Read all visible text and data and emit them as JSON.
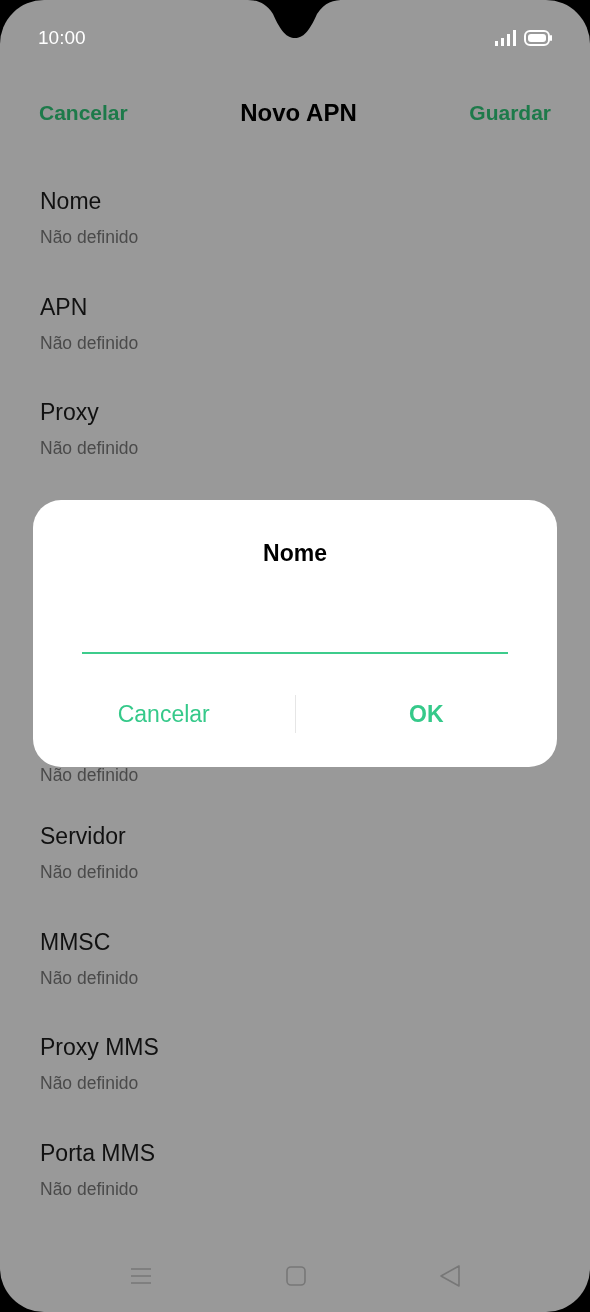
{
  "status_bar": {
    "time": "10:00"
  },
  "header": {
    "cancel": "Cancelar",
    "title": "Novo APN",
    "save": "Guardar"
  },
  "settings": [
    {
      "title": "Nome",
      "value": "Não definido"
    },
    {
      "title": "APN",
      "value": "Não definido"
    },
    {
      "title": "Proxy",
      "value": "Não definido"
    },
    {
      "value": "Não definido"
    },
    {
      "title": "Servidor",
      "value": "Não definido"
    },
    {
      "title": "MMSC",
      "value": "Não definido"
    },
    {
      "title": "Proxy MMS",
      "value": "Não definido"
    },
    {
      "title": "Porta MMS",
      "value": "Não definido"
    }
  ],
  "dialog": {
    "title": "Nome",
    "buttons": [
      {
        "label": "Cancelar",
        "primary": false
      },
      {
        "label": "OK",
        "primary": true
      }
    ]
  }
}
